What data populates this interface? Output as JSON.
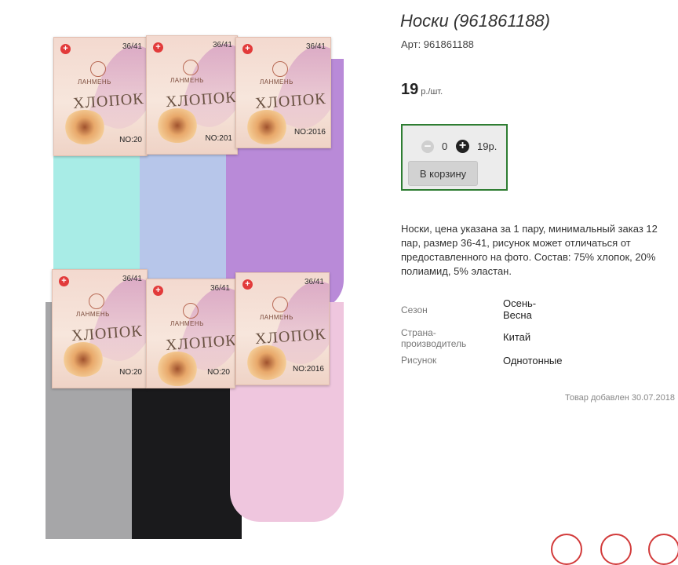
{
  "product": {
    "title": "Носки (961861188)",
    "sku": "Арт: 961861188",
    "price": "19",
    "price_unit": "р./шт.",
    "description": "Носки, цена указана за 1 пару, минимальный заказ 12 пар, размер 36-41, рисунок может отличаться от предоставленного на фото. Состав: 75% хлопок, 20% полиамид, 5% эластан.",
    "added_date": "Товар добавлен 30.07.2018"
  },
  "cart": {
    "minus_icon": "minus-circle-icon",
    "plus_icon": "plus-circle-icon",
    "quantity": "0",
    "total": "19р.",
    "add_button": "В корзину",
    "accent_color": "#2e7d32"
  },
  "properties": [
    {
      "key": "Сезон",
      "value": "Осень-\nВесна"
    },
    {
      "key": "Страна-\nпроизводитель",
      "value": "Китай"
    },
    {
      "key": "Рисунок",
      "value": "Однотонные"
    }
  ],
  "image": {
    "labels": [
      {
        "size": "36/41",
        "brand": "ЛАНМЕНЬ",
        "word": "ХЛОПОК",
        "no": "NO:20"
      },
      {
        "size": "36/41",
        "brand": "ЛАНМЕНЬ",
        "word": "ХЛОПОК",
        "no": "NO:201"
      },
      {
        "size": "36/41",
        "brand": "ЛАНМЕНЬ",
        "word": "ХЛОПОК",
        "no": "NO:2016"
      },
      {
        "size": "36/41",
        "brand": "ЛАНМЕНЬ",
        "word": "ХЛОПОК",
        "no": "NO:20"
      },
      {
        "size": "36/41",
        "brand": "ЛАНМЕНЬ",
        "word": "ХЛОПОК",
        "no": "NO:20"
      },
      {
        "size": "36/41",
        "brand": "ЛАНМЕНЬ",
        "word": "ХЛОПОК",
        "no": "NO:2016"
      }
    ],
    "sock_colors": [
      "#a8ece6",
      "#b7c6ea",
      "#b98ad8",
      "#a6a6a8",
      "#1a1a1c",
      "#efc6de"
    ]
  }
}
